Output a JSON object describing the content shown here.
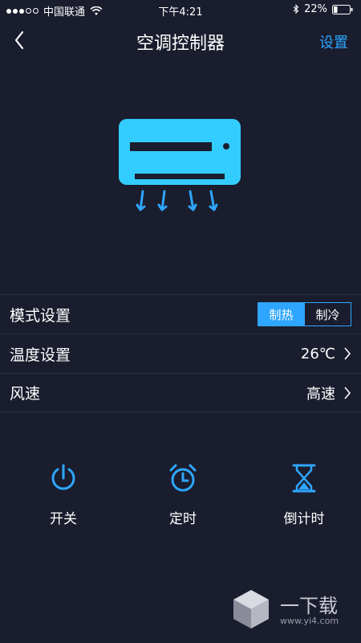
{
  "status_bar": {
    "carrier": "中国联通",
    "time": "下午4:21",
    "battery": "22%"
  },
  "nav": {
    "title": "空调控制器",
    "settings_label": "设置"
  },
  "settings": {
    "mode": {
      "label": "模式设置",
      "options": [
        "制热",
        "制冷"
      ],
      "selected": "制热"
    },
    "temperature": {
      "label": "温度设置",
      "value": "26℃"
    },
    "fan_speed": {
      "label": "风速",
      "value": "高速"
    }
  },
  "actions": [
    {
      "label": "开关",
      "icon": "power-icon"
    },
    {
      "label": "定时",
      "icon": "alarm-clock-icon"
    },
    {
      "label": "倒计时",
      "icon": "hourglass-icon"
    }
  ],
  "watermark": {
    "title": "一下载",
    "url": "www.yi4.com"
  },
  "colors": {
    "background": "#1a1d2e",
    "accent": "#2ea6ff",
    "ac_unit": "#33ccff"
  }
}
